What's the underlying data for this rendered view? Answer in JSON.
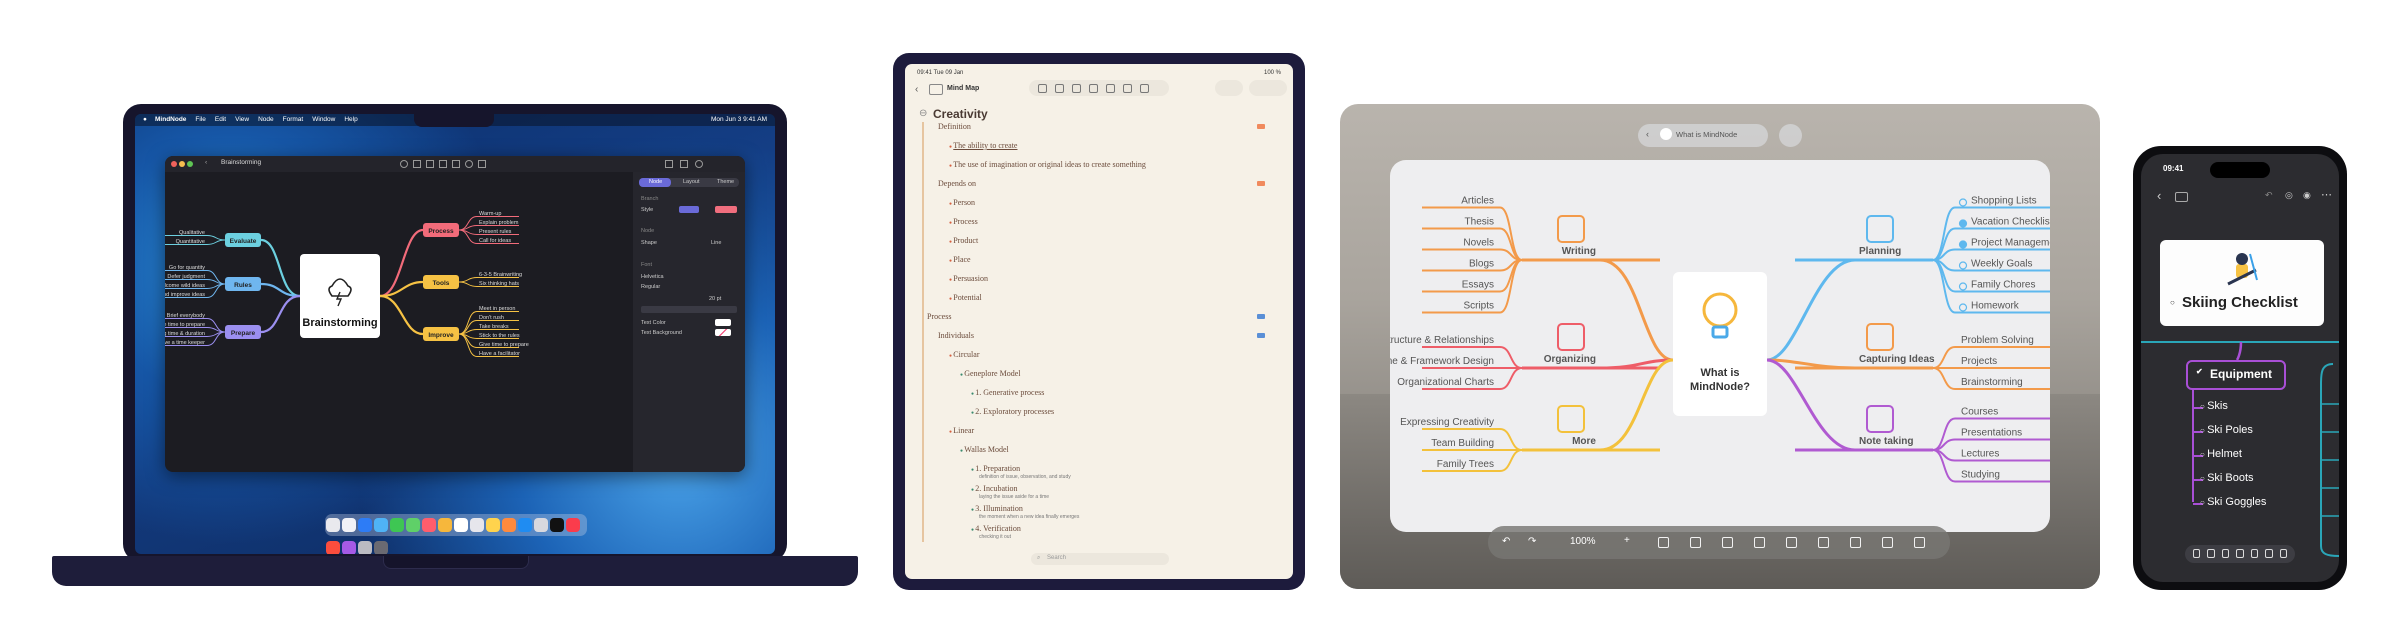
{
  "mac": {
    "menubar": {
      "app": "MindNode",
      "items": [
        "File",
        "Edit",
        "View",
        "Node",
        "Format",
        "Window",
        "Help"
      ],
      "clock": "Mon Jun 3 9:41 AM"
    },
    "window_title": "Brainstorming",
    "inspector": {
      "tabs": [
        "Node",
        "Layout",
        "Theme"
      ],
      "section_branch": "Branch",
      "style_label": "Style",
      "section_node": "Node",
      "shape_label": "Shape",
      "shape_value": "Line",
      "section_font": "Font",
      "font_value": "Helvetica",
      "weight_value": "Regular",
      "size_value": "20 pt",
      "text_color_label": "Text Color",
      "text_bg_label": "Text Background"
    },
    "mindmap": {
      "center": "Brainstorming",
      "branches": [
        {
          "label": "Process",
          "color": "#f26b7a",
          "children": [
            "Warm-up",
            "Explain problem",
            "Present rules",
            "Call for ideas"
          ]
        },
        {
          "label": "Tools",
          "color": "#f6c244",
          "children": [
            "6-3-5 Brainwriting",
            "Six thinking hats"
          ]
        },
        {
          "label": "Improve",
          "color": "#f6c244",
          "children": [
            "Meet in person",
            "Don't rush",
            "Take breaks",
            "Stick to the rules",
            "Give time to prepare",
            "Have a facilitator"
          ]
        },
        {
          "label": "Evaluate",
          "color": "#6cd0e0",
          "children": [
            "Qualitative",
            "Quantitative"
          ]
        },
        {
          "label": "Rules",
          "color": "#6fb6ef",
          "children": [
            "Go for quantity",
            "Defer judgment",
            "Welcome wild ideas",
            "Combine and improve ideas"
          ]
        },
        {
          "label": "Prepare",
          "color": "#9b8ff0",
          "children": [
            "Brief everybody",
            "Give time to prepare",
            "Set meeting time & duration",
            "Have a time keeper"
          ]
        }
      ]
    }
  },
  "ipad": {
    "status_left": "09:41 Tue 09 Jan",
    "status_right": "100 %",
    "doc_title": "Mind Map",
    "root": "Creativity",
    "outline": [
      {
        "text": "Definition",
        "level": 1,
        "style": "plain"
      },
      {
        "text": "The ability to create",
        "level": 2,
        "style": "underline"
      },
      {
        "text": "The use of imagination or original ideas to create something",
        "level": 2,
        "style": "plain"
      },
      {
        "text": "Depends on",
        "level": 1,
        "style": "plain"
      },
      {
        "text": "Person",
        "level": 2,
        "style": "plain"
      },
      {
        "text": "Process",
        "level": 2,
        "style": "plain"
      },
      {
        "text": "Product",
        "level": 2,
        "style": "plain"
      },
      {
        "text": "Place",
        "level": 2,
        "style": "plain"
      },
      {
        "text": "Persuasion",
        "level": 2,
        "style": "plain"
      },
      {
        "text": "Potential",
        "level": 2,
        "style": "plain"
      },
      {
        "text": "Process",
        "level": 0,
        "style": "plain"
      },
      {
        "text": "Individuals",
        "level": 1,
        "style": "plain"
      },
      {
        "text": "Circular",
        "level": 2,
        "style": "plain"
      },
      {
        "text": "Geneplore Model",
        "level": 3,
        "style": "plain"
      },
      {
        "text": "1. Generative process",
        "level": 4,
        "style": "plain"
      },
      {
        "text": "2. Exploratory processes",
        "level": 4,
        "style": "plain"
      },
      {
        "text": "Linear",
        "level": 2,
        "style": "plain"
      },
      {
        "text": "Wallas Model",
        "level": 3,
        "style": "plain"
      },
      {
        "text": "1. Preparation",
        "level": 4,
        "style": "plain",
        "note": "definition of issue, observation, and study"
      },
      {
        "text": "2. Incubation",
        "level": 4,
        "style": "plain",
        "note": "laying the issue aside for a time"
      },
      {
        "text": "3. Illumination",
        "level": 4,
        "style": "plain",
        "note": "the moment when a new idea finally emerges"
      },
      {
        "text": "4. Verification",
        "level": 4,
        "style": "plain",
        "note": "checking it out"
      }
    ],
    "search_placeholder": "Search"
  },
  "vision": {
    "title_pill": "What is MindNode",
    "zoom": "100%",
    "center": "What is MindNode?",
    "branches": [
      {
        "label": "Writing",
        "color": "#f39a4a",
        "side": "left",
        "children": [
          "Articles",
          "Thesis",
          "Novels",
          "Blogs",
          "Essays",
          "Scripts"
        ]
      },
      {
        "label": "Organizing",
        "color": "#ee5d68",
        "side": "left",
        "children": [
          "Structure & Relationships",
          "Outline & Framework Design",
          "Organizational Charts"
        ]
      },
      {
        "label": "More",
        "color": "#f3c13b",
        "side": "left",
        "children": [
          "Expressing Creativity",
          "Team Building",
          "Family Trees"
        ]
      },
      {
        "label": "Planning",
        "color": "#5eb8ee",
        "side": "right",
        "children": [
          "Shopping Lists",
          "Vacation Checklists",
          "Project Management",
          "Weekly Goals",
          "Family Chores",
          "Homework"
        ]
      },
      {
        "label": "Capturing Ideas",
        "color": "#f39a4a",
        "side": "right",
        "children": [
          "Problem Solving",
          "Projects",
          "Brainstorming"
        ]
      },
      {
        "label": "Note taking",
        "color": "#b05ad1",
        "side": "right",
        "children": [
          "Courses",
          "Presentations",
          "Lectures",
          "Studying"
        ]
      }
    ]
  },
  "iphone": {
    "time": "09:41",
    "card_title": "Skiing Checklist",
    "node": "Equipment",
    "items": [
      "Skis",
      "Ski Poles",
      "Helmet",
      "Ski Boots",
      "Ski Goggles"
    ]
  },
  "colors": {
    "mac_frame": "#16152c",
    "ipad_frame": "#1d1b3c",
    "ipad_paper": "#f6f1e7",
    "vision_panel": "#eeeef0",
    "iphone_accent": "#a94fd6"
  }
}
